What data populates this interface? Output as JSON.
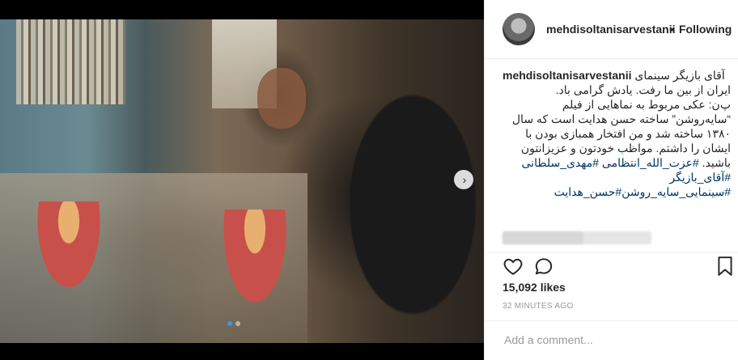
{
  "post": {
    "username": "mehdisoltanisarvestanii",
    "separator": "•",
    "follow_state": "Following"
  },
  "caption": {
    "username": "mehdisoltanisarvestanii",
    "line1": "آقای بازیگر سینمای",
    "line2": "ایران از بین ما رفت. یادش گرامی باد.",
    "line3": "پ‌ن: عکی مربوط به نماهایی از فیلم",
    "line4": "“سایه‌روشن” ساخته حسن هدایت است که سال",
    "line5": "۱۳۸۰ ساخته شد و من افتخار همبازی بودن با",
    "line6": "ایشان را داشتم. مواظب خودتون و عزیزانتون",
    "line7_prefix": "باشید.",
    "tag1": "#عزت_الله_انتظامی",
    "tag2": "#مهدی_سلطانی",
    "tag3": "#آقای_بازیگر",
    "tag4": "#سینمایی_سایه_روشن",
    "tag5": "#حسن_هدایت"
  },
  "stats": {
    "likes": "15,092 likes",
    "time": "32 MINUTES AGO"
  },
  "comment_box": {
    "placeholder": "Add a comment..."
  },
  "carousel": {
    "next_label": "›",
    "slide_count": 2,
    "active_index": 0
  },
  "icons": {
    "heart": "heart-icon",
    "comment": "comment-icon",
    "bookmark": "bookmark-icon",
    "next": "chevron-right-icon"
  },
  "colors": {
    "link": "#003569",
    "active_dot": "#3897f0",
    "text": "#262626",
    "muted": "#999999"
  }
}
